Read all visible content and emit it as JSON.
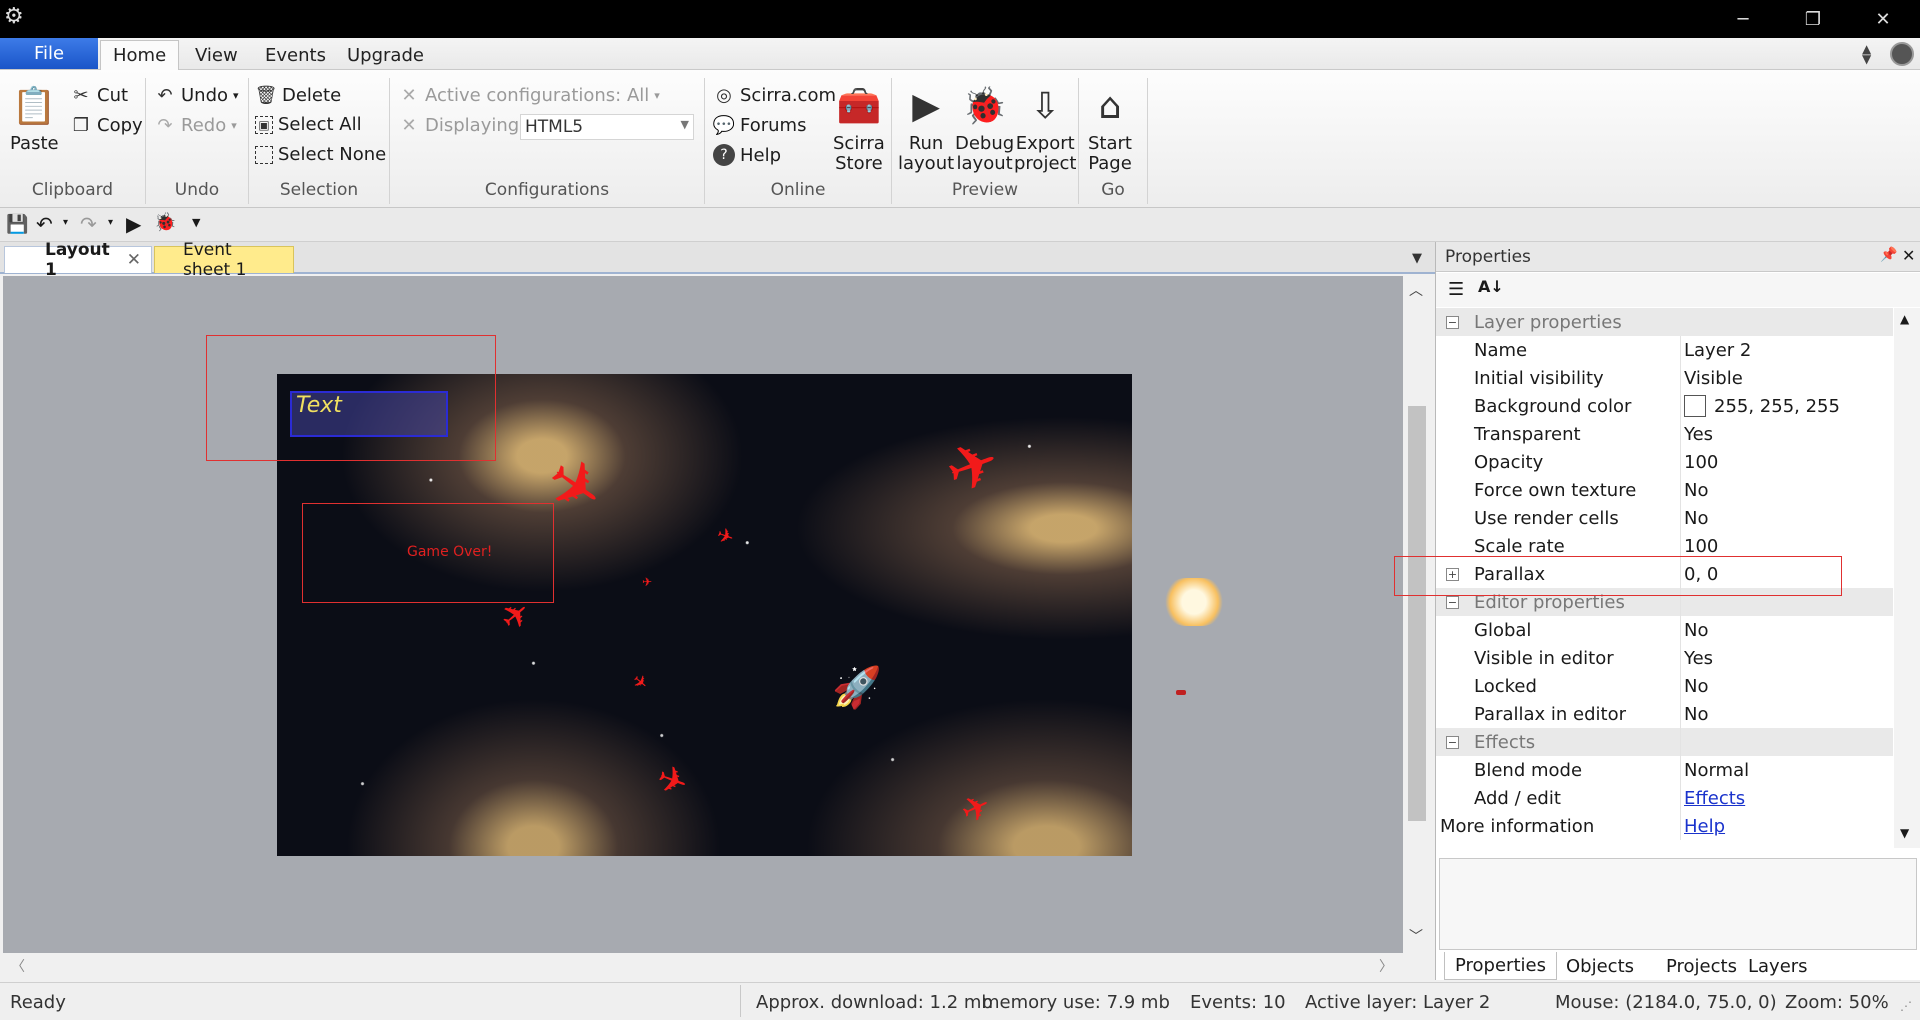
{
  "window": {
    "minimize": "─",
    "restore": "❐",
    "close": "✕"
  },
  "menu": {
    "file": "File",
    "tabs": [
      "Home",
      "View",
      "Events",
      "Upgrade"
    ]
  },
  "ribbon": {
    "clipboard": {
      "paste": "Paste",
      "cut": "Cut",
      "copy": "Copy",
      "label": "Clipboard"
    },
    "undo": {
      "undo": "Undo",
      "redo": "Redo",
      "label": "Undo"
    },
    "selection": {
      "delete": "Delete",
      "select_all": "Select All",
      "select_none": "Select None",
      "label": "Selection"
    },
    "configurations": {
      "active": "Active configurations: All",
      "displaying_label": "Displaying:",
      "displaying_value": "HTML5",
      "label": "Configurations"
    },
    "online": {
      "scirra": "Scirra.com",
      "forums": "Forums",
      "help": "Help",
      "store_l1": "Scirra",
      "store_l2": "Store",
      "label": "Online"
    },
    "preview": {
      "run_l1": "Run",
      "run_l2": "layout",
      "debug_l1": "Debug",
      "debug_l2": "layout",
      "export_l1": "Export",
      "export_l2": "project",
      "label": "Preview"
    },
    "go": {
      "start_l1": "Start",
      "start_l2": "Page",
      "label": "Go"
    }
  },
  "doc_tabs": {
    "layout": "Layout 1",
    "events": "Event sheet 1"
  },
  "canvas": {
    "text_object": "Text",
    "game_over": "Game Over!"
  },
  "properties": {
    "title": "Properties",
    "categories": {
      "layer": "Layer properties",
      "editor": "Editor properties",
      "effects": "Effects"
    },
    "layer": [
      {
        "name": "Name",
        "value": "Layer 2"
      },
      {
        "name": "Initial visibility",
        "value": "Visible"
      },
      {
        "name": "Background color",
        "value": "255, 255, 255"
      },
      {
        "name": "Transparent",
        "value": "Yes"
      },
      {
        "name": "Opacity",
        "value": "100"
      },
      {
        "name": "Force own texture",
        "value": "No"
      },
      {
        "name": "Use render cells",
        "value": "No"
      },
      {
        "name": "Scale rate",
        "value": "100"
      },
      {
        "name": "Parallax",
        "value": "0, 0"
      }
    ],
    "editor": [
      {
        "name": "Global",
        "value": "No"
      },
      {
        "name": "Visible in editor",
        "value": "Yes"
      },
      {
        "name": "Locked",
        "value": "No"
      },
      {
        "name": "Parallax in editor",
        "value": "No"
      }
    ],
    "effects": [
      {
        "name": "Blend mode",
        "value": "Normal"
      },
      {
        "name": "Add / edit",
        "value": "Effects"
      }
    ],
    "more_info": {
      "name": "More information",
      "value": "Help"
    }
  },
  "bottom_tabs": [
    "Properties",
    "Objects",
    "Projects",
    "Layers"
  ],
  "status": {
    "ready": "Ready",
    "download": "Approx. download: 1.2 mb",
    "memory": "memory use: 7.9 mb",
    "events": "Events: 10",
    "layer": "Active layer: Layer 2",
    "mouse": "Mouse: (2184.0, 75.0, 0)",
    "zoom": "Zoom: 50%"
  }
}
